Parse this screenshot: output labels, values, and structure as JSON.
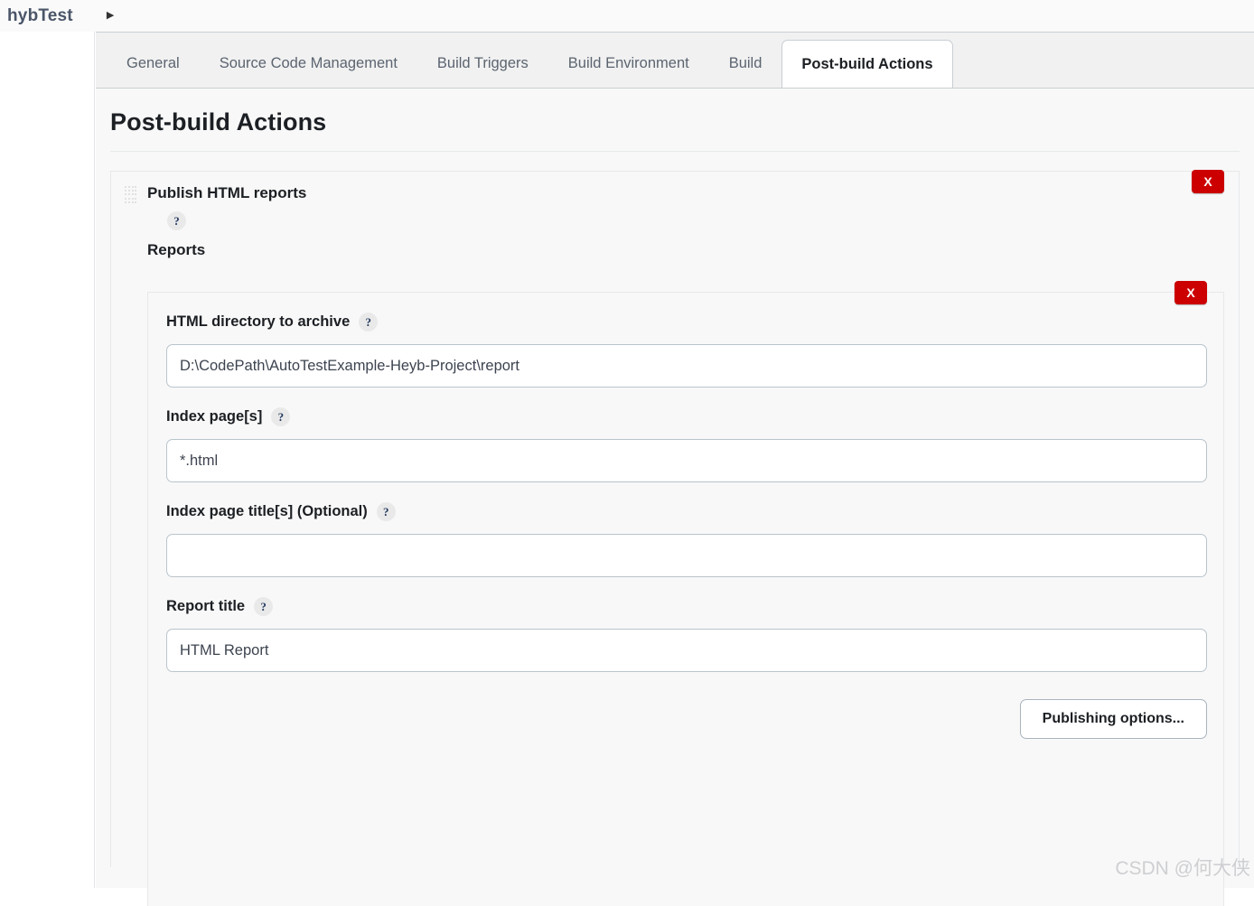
{
  "breadcrumb": {
    "project": "hybTest",
    "arrow_icon": "caret-right-icon"
  },
  "tabs": [
    {
      "label": "General",
      "active": false
    },
    {
      "label": "Source Code Management",
      "active": false
    },
    {
      "label": "Build Triggers",
      "active": false
    },
    {
      "label": "Build Environment",
      "active": false
    },
    {
      "label": "Build",
      "active": false
    },
    {
      "label": "Post-build Actions",
      "active": true
    }
  ],
  "page": {
    "title": "Post-build Actions"
  },
  "publisher": {
    "title": "Publish HTML reports",
    "help_glyph": "?",
    "reports_label": "Reports",
    "delete_label": "X",
    "drag_handle_icon": "drag-grip-icon"
  },
  "report": {
    "delete_label": "X",
    "fields": [
      {
        "label": "HTML directory to archive",
        "value": "D:\\CodePath\\AutoTestExample-Heyb-Project\\report",
        "placeholder": ""
      },
      {
        "label": "Index page[s]",
        "value": "*.html",
        "placeholder": ""
      },
      {
        "label": "Index page title[s] (Optional)",
        "value": "",
        "placeholder": ""
      },
      {
        "label": "Report title",
        "value": "HTML Report",
        "placeholder": ""
      }
    ],
    "publishing_options_label": "Publishing options..."
  },
  "watermark": {
    "text": "CSDN @何大侠"
  },
  "colors": {
    "danger": "#cc0000",
    "tab_bar_bg": "#f1f1f1",
    "content_bg": "#f8f8f8",
    "border": "#e6e8ea",
    "input_border": "#b9c4cc",
    "text_primary": "#1c1f23",
    "text_muted": "#5b6470"
  }
}
